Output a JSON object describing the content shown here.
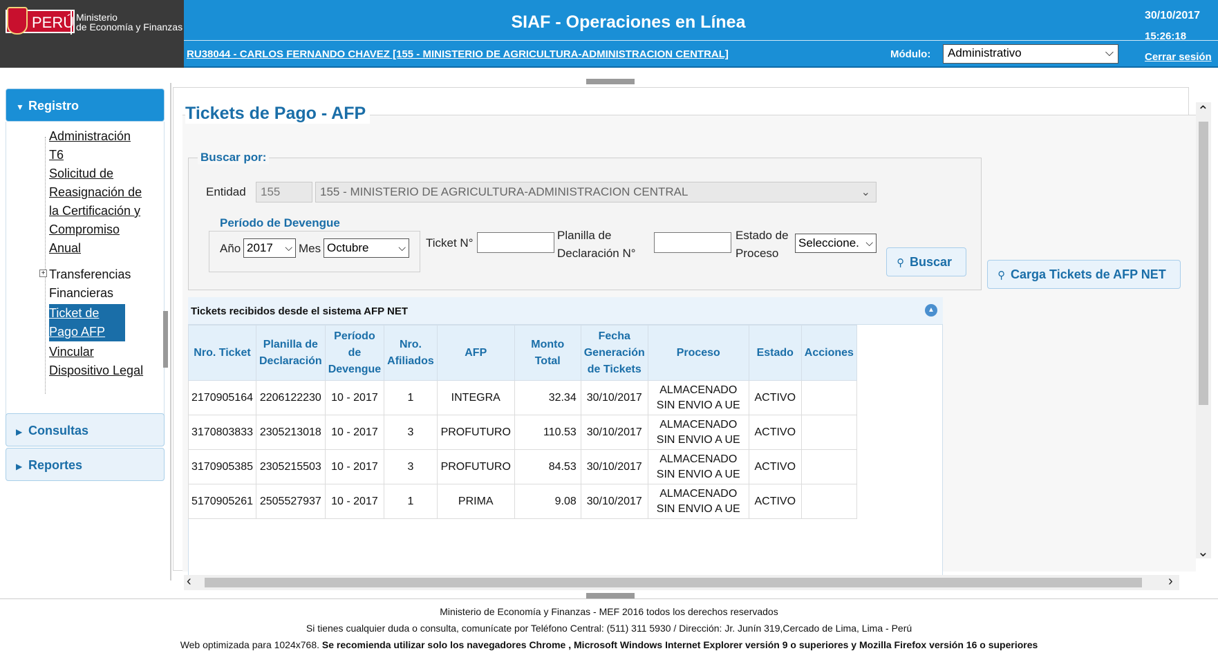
{
  "header": {
    "logo_country": "PERÚ",
    "logo_ministry_line1": "Ministerio",
    "logo_ministry_line2": "de Economía y Finanzas",
    "title": "SIAF - Operaciones en Línea",
    "user": "RU38044  - CARLOS FERNANDO CHAVEZ [155 - MINISTERIO DE AGRICULTURA-ADMINISTRACION CENTRAL]",
    "modulo_label": "Módulo:",
    "modulo_value": "Administrativo",
    "date": "30/10/2017",
    "time": "15:26:18",
    "logout": "Cerrar sesión"
  },
  "sidebar": {
    "registro": "Registro",
    "items": [
      "Administración T6",
      "Solicitud de Reasignación de la Certificación y Compromiso Anual",
      "Transferencias Financieras",
      "Ticket de Pago AFP",
      "Vincular Dispositivo Legal"
    ],
    "consultas": "Consultas",
    "reportes": "Reportes"
  },
  "page": {
    "title": "Tickets de Pago - AFP",
    "search_legend": "Buscar por:",
    "entidad_label": "Entidad",
    "entidad_code": "155",
    "entidad_name": "155 - MINISTERIO DE AGRICULTURA-ADMINISTRACION CENTRAL",
    "periodo_legend": "Período de Devengue",
    "anio_label": "Año",
    "anio_value": "2017",
    "mes_label": "Mes",
    "mes_value": "Octubre",
    "ticket_label": "Ticket N°",
    "planilla_label_1": "Planilla de",
    "planilla_label_2": "Declaración N°",
    "estado_label_1": "Estado de",
    "estado_label_2": "Proceso",
    "estado_value": "Seleccione.",
    "buscar_button": "Buscar",
    "carga_button": "Carga Tickets de AFP NET"
  },
  "grid": {
    "caption": "Tickets recibidos desde el sistema AFP NET",
    "columns": [
      [
        "Nro. Ticket"
      ],
      [
        "Planilla de",
        "Declaración"
      ],
      [
        "Período",
        "de",
        "Devengue"
      ],
      [
        "Nro.",
        "Afiliados"
      ],
      [
        "AFP"
      ],
      [
        "Monto Total"
      ],
      [
        "Fecha",
        "Generación",
        "de Tickets"
      ],
      [
        "Proceso"
      ],
      [
        "Estado"
      ],
      [
        "Acciones"
      ]
    ],
    "rows": [
      [
        "2170905164",
        "2206122230",
        "10 - 2017",
        "1",
        "INTEGRA",
        "32.34",
        "30/10/2017",
        "ALMACENADO SIN ENVIO A UE",
        "ACTIVO",
        ""
      ],
      [
        "3170803833",
        "2305213018",
        "10 - 2017",
        "3",
        "PROFUTURO",
        "110.53",
        "30/10/2017",
        "ALMACENADO SIN ENVIO A UE",
        "ACTIVO",
        ""
      ],
      [
        "3170905385",
        "2305215503",
        "10 - 2017",
        "3",
        "PROFUTURO",
        "84.53",
        "30/10/2017",
        "ALMACENADO SIN ENVIO A UE",
        "ACTIVO",
        ""
      ],
      [
        "5170905261",
        "2505527937",
        "10 - 2017",
        "1",
        "PRIMA",
        "9.08",
        "30/10/2017",
        "ALMACENADO SIN ENVIO A UE",
        "ACTIVO",
        ""
      ]
    ]
  },
  "footer": {
    "line1": "Ministerio de Economía y Finanzas - MEF 2016 todos los derechos reservados",
    "line2": "Si tienes cualquier duda o consulta, comunícate por Teléfono Central: (511) 311 5930 / Dirección: Jr. Junín 319,Cercado de Lima, Lima - Perú",
    "line3_plain": "Web optimizada para 1024x768. ",
    "line3_bold": "Se recomienda utilizar solo los navegadores Chrome , Microsoft Windows Internet Explorer versión 9 o superiores y Mozilla Firefox versión 16 o superiores"
  },
  "colors": {
    "header_blue": "#1a8fd6",
    "title_blue": "#1a6ea8",
    "selected_item": "#1a6ea8"
  }
}
